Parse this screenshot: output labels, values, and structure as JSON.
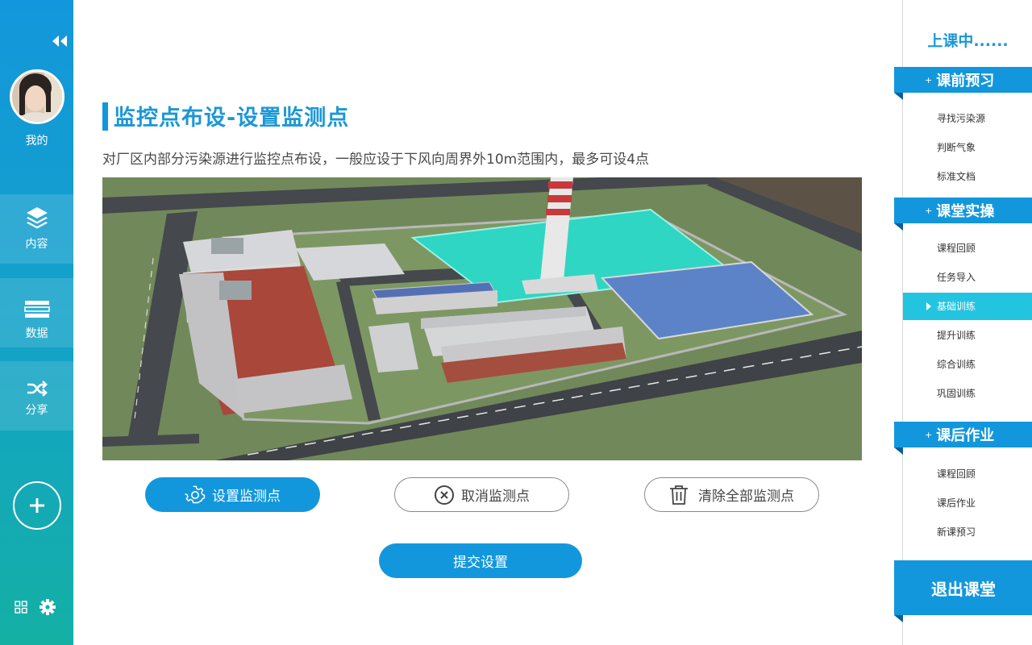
{
  "sidebar": {
    "me_label": "我的",
    "nav": [
      {
        "label": "内容",
        "icon": "layers-icon"
      },
      {
        "label": "数据",
        "icon": "data-icon"
      },
      {
        "label": "分享",
        "icon": "shuffle-icon"
      }
    ],
    "icons": [
      "double-chevron-left-icon",
      "plus-icon",
      "grid-icon",
      "gear-icon"
    ]
  },
  "main": {
    "title": "监控点布设-设置监测点",
    "description": "对厂区内部分污染源进行监控点布设，一般应设于下风向周界外10m范围内，最多可设4点",
    "buttons": {
      "set": "设置监测点",
      "cancel": "取消监测点",
      "clear": "清除全部监测点",
      "submit": "提交设置"
    }
  },
  "right": {
    "status": "上课中......",
    "sections": [
      {
        "title": "课前预习",
        "items": [
          "寻找污染源",
          "判断气象",
          "标准文档"
        ]
      },
      {
        "title": "课堂实操",
        "items": [
          "课程回顾",
          "任务导入",
          "基础训练",
          "提升训练",
          "综合训练",
          "巩固训练"
        ]
      },
      {
        "title": "课后作业",
        "items": [
          "课程回顾",
          "课后作业",
          "新课预习"
        ]
      }
    ],
    "active_item": "基础训练",
    "exit": "退出课堂"
  },
  "colors": {
    "primary": "#1397dc",
    "active": "#23c4e0",
    "sidebar_bottom": "#14b0a4"
  }
}
